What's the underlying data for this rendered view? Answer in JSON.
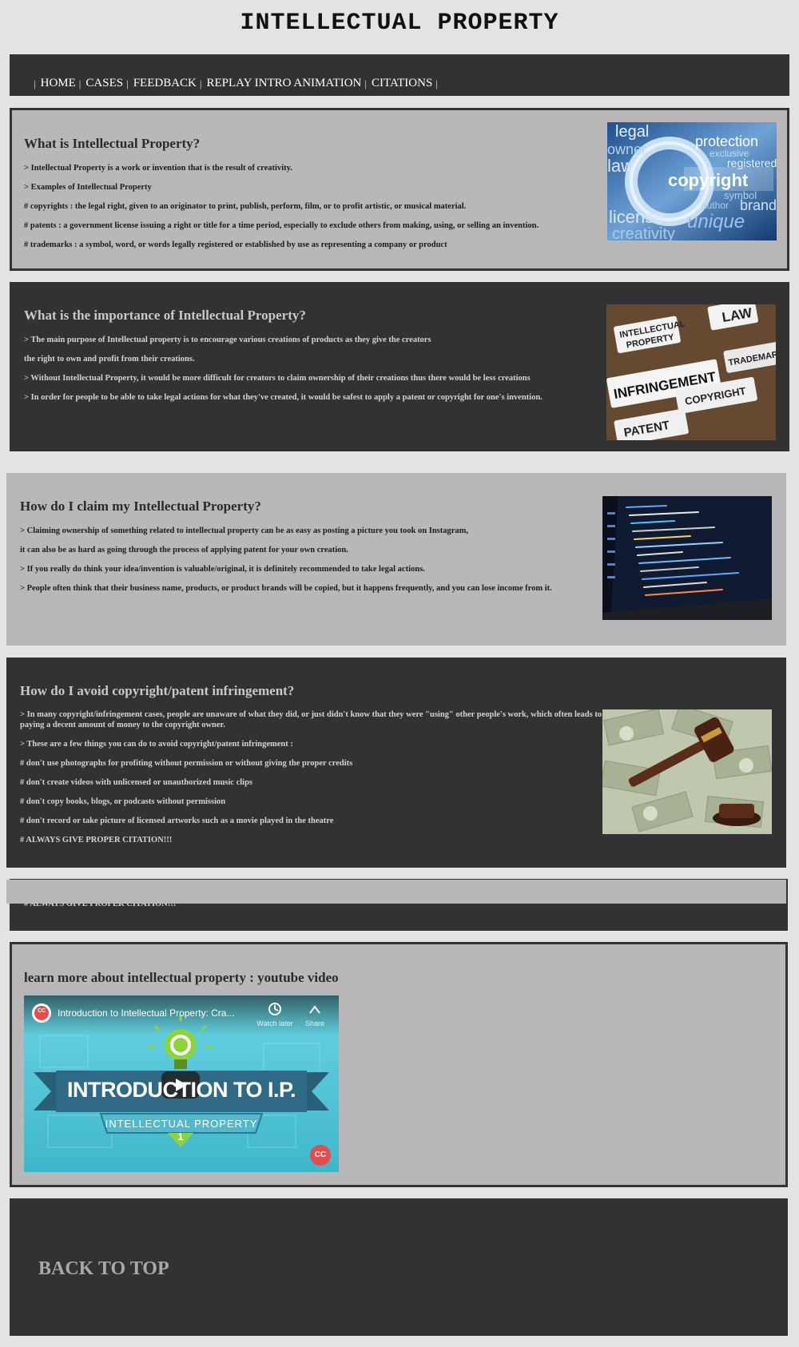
{
  "site": {
    "title": "INTELLECTUAL  PROPERTY"
  },
  "nav": {
    "separator": "|",
    "items": [
      {
        "label": "HOME"
      },
      {
        "label": "CASES"
      },
      {
        "label": "FEEDBACK"
      },
      {
        "label": "REPLAY INTRO ANIMATION"
      },
      {
        "label": "CITATIONS"
      }
    ]
  },
  "sections": [
    {
      "title": "What is Intellectual Property?",
      "lines": [
        "> Intellectual Property is a work or invention that is the result of creativity.",
        "> Examples of Intellectual Property",
        "# copyrights : the legal right, given to an originator to print, publish, perform, film, or to profit artistic, or musical material.",
        "# patents : a government license issuing a right or title for a time period, especially to exclude others from making, using, or selling an invention.",
        "# trademarks : a symbol, word, or words legally registered or established by use as representing a company or product"
      ],
      "image": {
        "words": [
          "copyright",
          "legal",
          "protection",
          "license",
          "creativity",
          "unique",
          "brand",
          "registered",
          "exclusive",
          "owner",
          "law",
          "symbol",
          "author"
        ]
      }
    },
    {
      "title": "What is the importance of Intellectual Property?",
      "lines": [
        "> The main purpose of Intellectual property is to encourage various creations of products as they give the creators",
        "the right to own and profit from their creations.",
        "> Without Intellectual Property, it would be more difficult for creators to claim ownership of their creations thus there would be less creations",
        "> In order for people to be able to take legal actions for what they've created, it would be safest to apply a patent or copyright for one's invention."
      ],
      "image": {
        "tabs": [
          "INTELLECTUAL",
          "PROPERTY",
          "LAW",
          "INFRINGEMENT",
          "TRADEMARK",
          "COPYRIGHT",
          "PATENT"
        ]
      }
    },
    {
      "title": "How do I claim my Intellectual Property?",
      "lines": [
        "> Claiming ownership of something related to intellectual property can be as easy as posting a picture you took on Instagram,",
        "it can also be as hard as going through the process of applying patent for your own creation.",
        "> If you really do think your idea/invention is valuable/original, it is definitely recommended to take legal actions.",
        "> People often think that their business name, products, or product brands will be copied, but it happens frequently, and you can lose income from it."
      ]
    },
    {
      "title": "How do I avoid copyright/patent infringement?",
      "lines": [
        "> In many copyright/infringement cases, people are unaware of what they did, or just didn't know that they were \"using\" other people's work, which often leads to paying a decent amount of money to the copyright owner.",
        "> These are a few things you can do to avoid copyright/patent infringement :",
        "# don't use photographs for profiting without permission or without giving the proper credits",
        "# don't create videos with unlicensed or unauthorized music clips",
        "# don't copy books, blogs, or podcasts without permission",
        "# don't record or take picture of licensed artworks such as a movie played in the theatre",
        "# ALWAYS GIVE PROPER CITATION!!!"
      ]
    }
  ],
  "overflow_text": "# ALWAYS GIVE PROPER CITATION!!!",
  "video_section": {
    "title": "learn more about intellectual property : youtube video",
    "video": {
      "title": "Introduction to Intellectual Property: Cra...",
      "watch_later": "Watch later",
      "share": "Share",
      "banner": "INTRODUCTION TO I.P.",
      "ribbon": "INTELLECTUAL PROPERTY",
      "episode": "1",
      "channel_badge": "CC"
    }
  },
  "footer": {
    "back_to_top": "BACK TO TOP"
  },
  "colors": {
    "page_bg": "#e3e3e3",
    "dark_panel": "#323232",
    "light_panel": "#b9b7b8",
    "video_bg": "#5ccbd8",
    "accent_green": "#8bd43b"
  }
}
